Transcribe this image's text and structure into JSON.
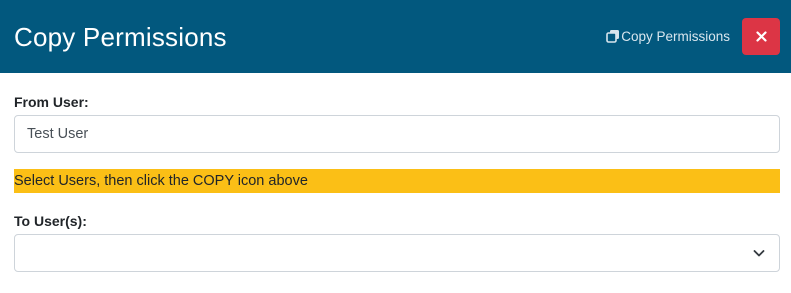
{
  "header": {
    "title": "Copy Permissions",
    "copy_label": "Copy Permissions",
    "copy_icon": "copy-icon",
    "close_icon": "close-icon",
    "background_color": "#02587e",
    "close_color": "#dc3545"
  },
  "from_user": {
    "label": "From User:",
    "value": "Test User"
  },
  "banner": {
    "text": "Select Users, then click the COPY icon above",
    "color": "#fbbf16"
  },
  "to_users": {
    "label": "To User(s):",
    "selected": "",
    "icon": "chevron-down-icon"
  }
}
